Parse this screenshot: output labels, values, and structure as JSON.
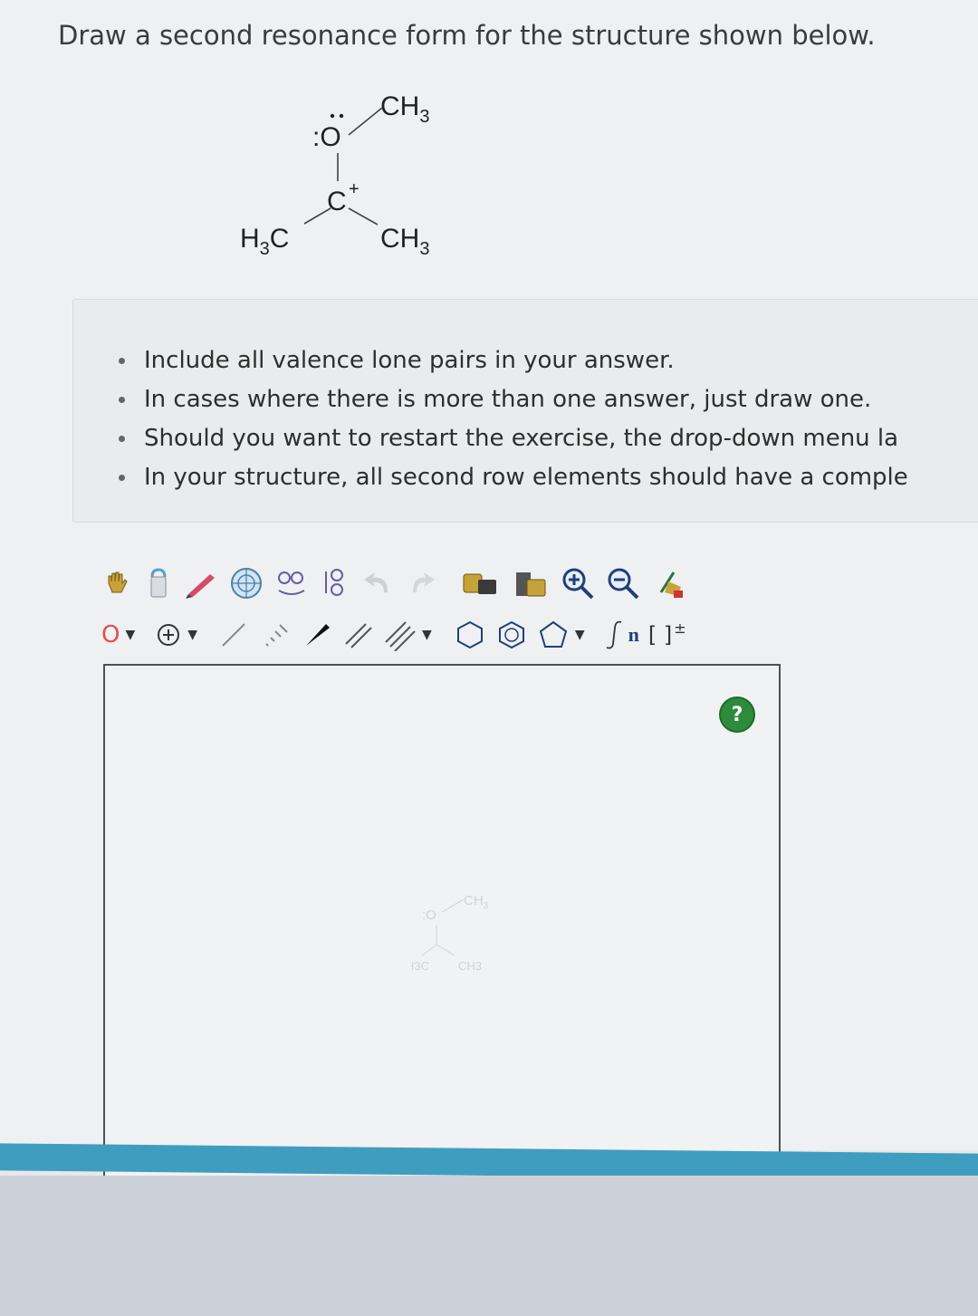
{
  "prompt": "Draw a second resonance form for the structure shown below.",
  "molecule": {
    "top_group": "CH",
    "top_sub": "3",
    "oxygen": ":O",
    "carbon": "C",
    "charge": "+",
    "left_group_a": "H",
    "left_sub": "3",
    "left_group_b": "C",
    "right_group": "CH",
    "right_sub": "3"
  },
  "instructions": [
    "Include all valence lone pairs in your answer.",
    "In cases where there is more than one answer, just draw one.",
    "Should you want to restart the exercise, the drop-down menu la",
    "In your structure, all second row elements should have a comple"
  ],
  "toolbar": {
    "element_label": "O",
    "caret": "▼",
    "subscript_n": "n",
    "bracket_label": "[ ]",
    "bracket_charge": "±"
  },
  "canvas": {
    "help_label": "?",
    "ghost_top": "CH",
    "ghost_sub": "3",
    "ghost_oxygen": ":O",
    "ghost_left": "H3C",
    "ghost_right": "CH3"
  }
}
